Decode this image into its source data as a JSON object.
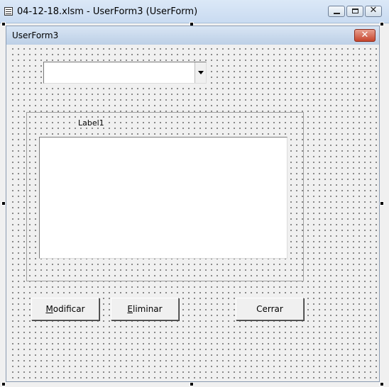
{
  "window": {
    "title": "04-12-18.xlsm - UserForm3 (UserForm)",
    "icons": [
      "window-icon",
      "minimize-icon",
      "maximize-icon",
      "close-icon"
    ]
  },
  "form": {
    "caption": "UserForm3",
    "close_glyph": "✕"
  },
  "combobox": {
    "value": ""
  },
  "frame": {
    "label": "Label1"
  },
  "listbox": {
    "items": []
  },
  "buttons": {
    "modificar": {
      "access_key": "M",
      "rest": "odificar"
    },
    "eliminar": {
      "access_key": "E",
      "rest": "liminar"
    },
    "cerrar": {
      "label": "Cerrar"
    }
  },
  "colors": {
    "form_title_gradient_top": "#d8e5f4",
    "close_button": "#c6452d"
  }
}
